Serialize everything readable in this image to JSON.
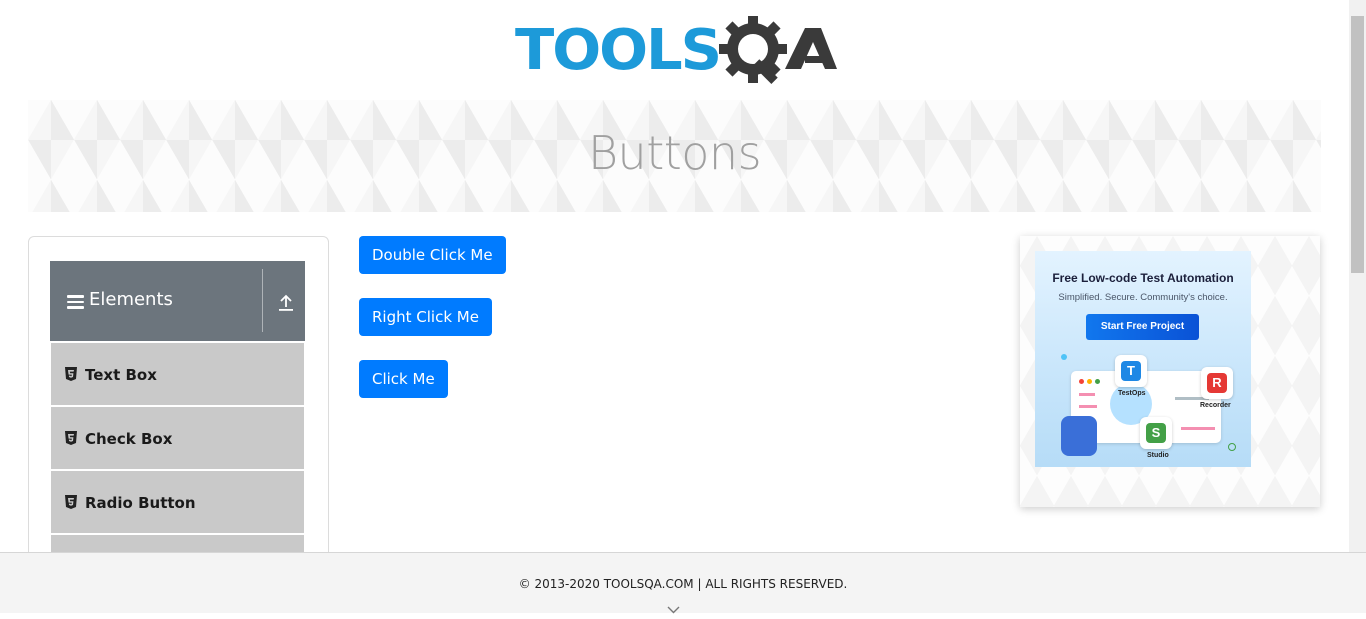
{
  "header": {
    "logo_text": "TOOLSQA",
    "logo_color": "#1d9ad9",
    "logo_dark_color": "#3a3a3a"
  },
  "banner": {
    "title": "Buttons"
  },
  "sidebar": {
    "group": {
      "label": "Elements",
      "icon": "menu-icon",
      "toggle_icon": "upload-icon"
    },
    "items": [
      {
        "label": "Text Box",
        "icon": "html5-icon"
      },
      {
        "label": "Check Box",
        "icon": "html5-icon"
      },
      {
        "label": "Radio Button",
        "icon": "html5-icon"
      }
    ]
  },
  "buttons": {
    "double_click": "Double Click Me",
    "right_click": "Right Click Me",
    "click": "Click Me",
    "color": "#007bff"
  },
  "ad": {
    "headline": "Free Low-code Test Automation",
    "subline": "Simplified. Secure. Community's choice.",
    "cta": "Start Free Project",
    "tiles": [
      {
        "letter": "T",
        "label": "TestOps",
        "color": "#1e88e5"
      },
      {
        "letter": "R",
        "label": "Recorder",
        "color": "#e53935"
      },
      {
        "letter": "S",
        "label": "Studio",
        "color": "#43a047"
      }
    ]
  },
  "footer": {
    "copyright": "© 2013-2020 TOOLSQA.COM | ALL RIGHTS RESERVED."
  }
}
